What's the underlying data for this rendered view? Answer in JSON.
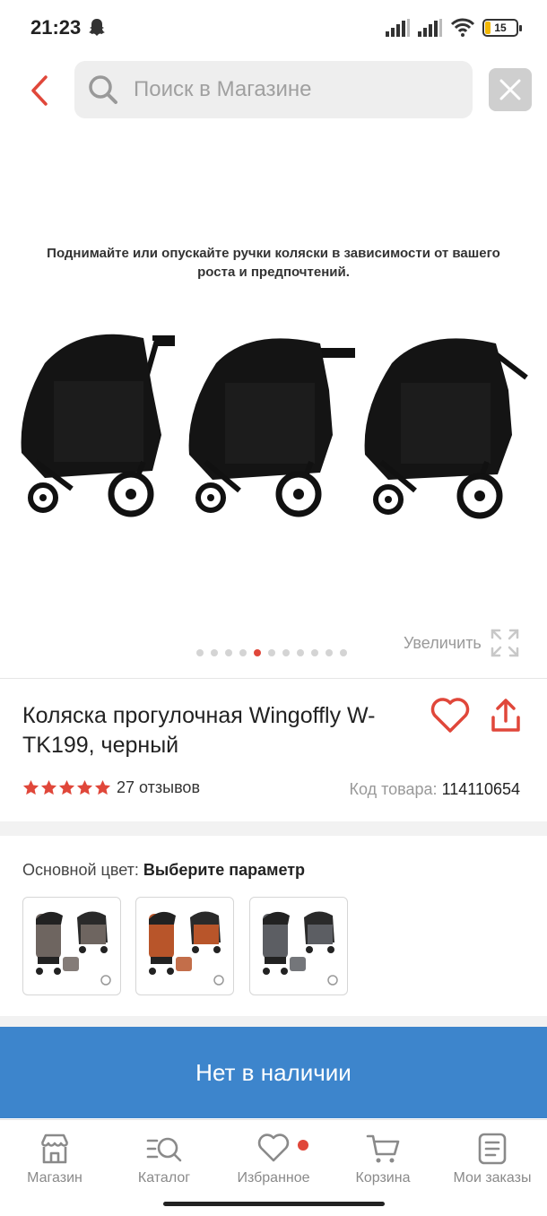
{
  "status_bar": {
    "time": "21:23",
    "battery": "15",
    "battery_color": "#f2b705"
  },
  "header": {
    "search_placeholder": "Поиск в Магазине",
    "back_icon": "chevron-left-icon",
    "close_icon": "close-icon",
    "accent": "#e0473a"
  },
  "gallery": {
    "caption": "Поднимайте или опускайте ручки коляски в зависимости от вашего роста и предпочтений.",
    "zoom_label": "Увеличить",
    "slide_count": 11,
    "active_slide": 4
  },
  "product": {
    "title": "Коляска прогулочная Wingoffly W-TK199, черный",
    "rating": 5,
    "reviews": "27 отзывов",
    "sku_label": "Код товара:",
    "sku_value": "114110654"
  },
  "color": {
    "label": "Основной цвет:",
    "value": "Выберите параметр",
    "swatches": [
      {
        "name": "grey-brown",
        "tone": "#6e6560"
      },
      {
        "name": "orange",
        "tone": "#b8552a"
      },
      {
        "name": "grey",
        "tone": "#5c5e63"
      }
    ]
  },
  "cta": {
    "label": "Нет в наличии",
    "color": "#3d85cc"
  },
  "nav": {
    "items": [
      {
        "label": "Магазин",
        "icon": "store-icon"
      },
      {
        "label": "Каталог",
        "icon": "catalog-search-icon"
      },
      {
        "label": "Избранное",
        "icon": "heart-icon"
      },
      {
        "label": "Корзина",
        "icon": "cart-icon"
      },
      {
        "label": "Мои заказы",
        "icon": "orders-icon"
      }
    ]
  }
}
